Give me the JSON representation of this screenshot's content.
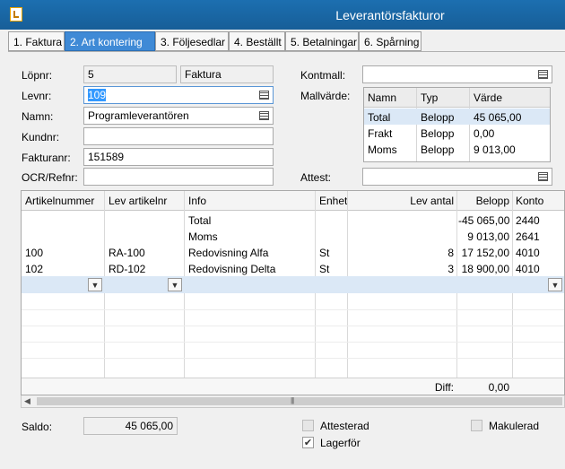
{
  "window": {
    "title": "Leverantörsfakturor"
  },
  "tabs": [
    {
      "label": "1. Faktura"
    },
    {
      "label": "2. Art kontering"
    },
    {
      "label": "3. Följesedlar"
    },
    {
      "label": "4. Beställt"
    },
    {
      "label": "5. Betalningar"
    },
    {
      "label": "6. Spårning"
    }
  ],
  "form": {
    "lopnr_label": "Löpnr:",
    "lopnr_value": "5",
    "doc_type": "Faktura",
    "levnr_label": "Levnr:",
    "levnr_value": "109",
    "namn_label": "Namn:",
    "namn_value": "Programleverantören",
    "kundnr_label": "Kundnr:",
    "kundnr_value": "",
    "fakturanr_label": "Fakturanr:",
    "fakturanr_value": "151589",
    "ocr_label": "OCR/Refnr:",
    "ocr_value": "",
    "kontmall_label": "Kontmall:",
    "kontmall_value": "",
    "mallvarde_label": "Mallvärde:",
    "attest_label": "Attest:",
    "attest_value": ""
  },
  "mallvarde": {
    "headers": [
      "Namn",
      "Typ",
      "Värde"
    ],
    "rows": [
      {
        "namn": "Total",
        "typ": "Belopp",
        "varde": "45 065,00"
      },
      {
        "namn": "Frakt",
        "typ": "Belopp",
        "varde": "0,00"
      },
      {
        "namn": "Moms",
        "typ": "Belopp",
        "varde": "9 013,00"
      }
    ]
  },
  "grid": {
    "headers": [
      "Artikelnummer",
      "Lev artikelnr",
      "Info",
      "Enhet",
      "Lev antal",
      "Belopp",
      "Konto"
    ],
    "rows": [
      {
        "artikelnummer": "",
        "lev_artikelnr": "",
        "info": "Total",
        "enhet": "",
        "lev_antal": "",
        "belopp": "-45 065,00",
        "konto": "2440"
      },
      {
        "artikelnummer": "",
        "lev_artikelnr": "",
        "info": "Moms",
        "enhet": "",
        "lev_antal": "",
        "belopp": "9 013,00",
        "konto": "2641"
      },
      {
        "artikelnummer": "100",
        "lev_artikelnr": "RA-100",
        "info": "Redovisning Alfa",
        "enhet": "St",
        "lev_antal": "8",
        "belopp": "17 152,00",
        "konto": "4010"
      },
      {
        "artikelnummer": "102",
        "lev_artikelnr": "RD-102",
        "info": "Redovisning Delta",
        "enhet": "St",
        "lev_antal": "3",
        "belopp": "18 900,00",
        "konto": "4010"
      }
    ],
    "diff_label": "Diff:",
    "diff_value": "0,00"
  },
  "bottom": {
    "saldo_label": "Saldo:",
    "saldo_value": "45 065,00",
    "attesterad_label": "Attesterad",
    "attesterad_checked": false,
    "lagerfor_label": "Lagerför",
    "lagerfor_checked": true,
    "makulerad_label": "Makulerad",
    "makulerad_checked": false
  },
  "colors": {
    "titlebar": "#1c6fb0",
    "active_tab": "#3f8ad6",
    "selection": "#3399ff",
    "row_highlight": "#dbe8f6"
  }
}
